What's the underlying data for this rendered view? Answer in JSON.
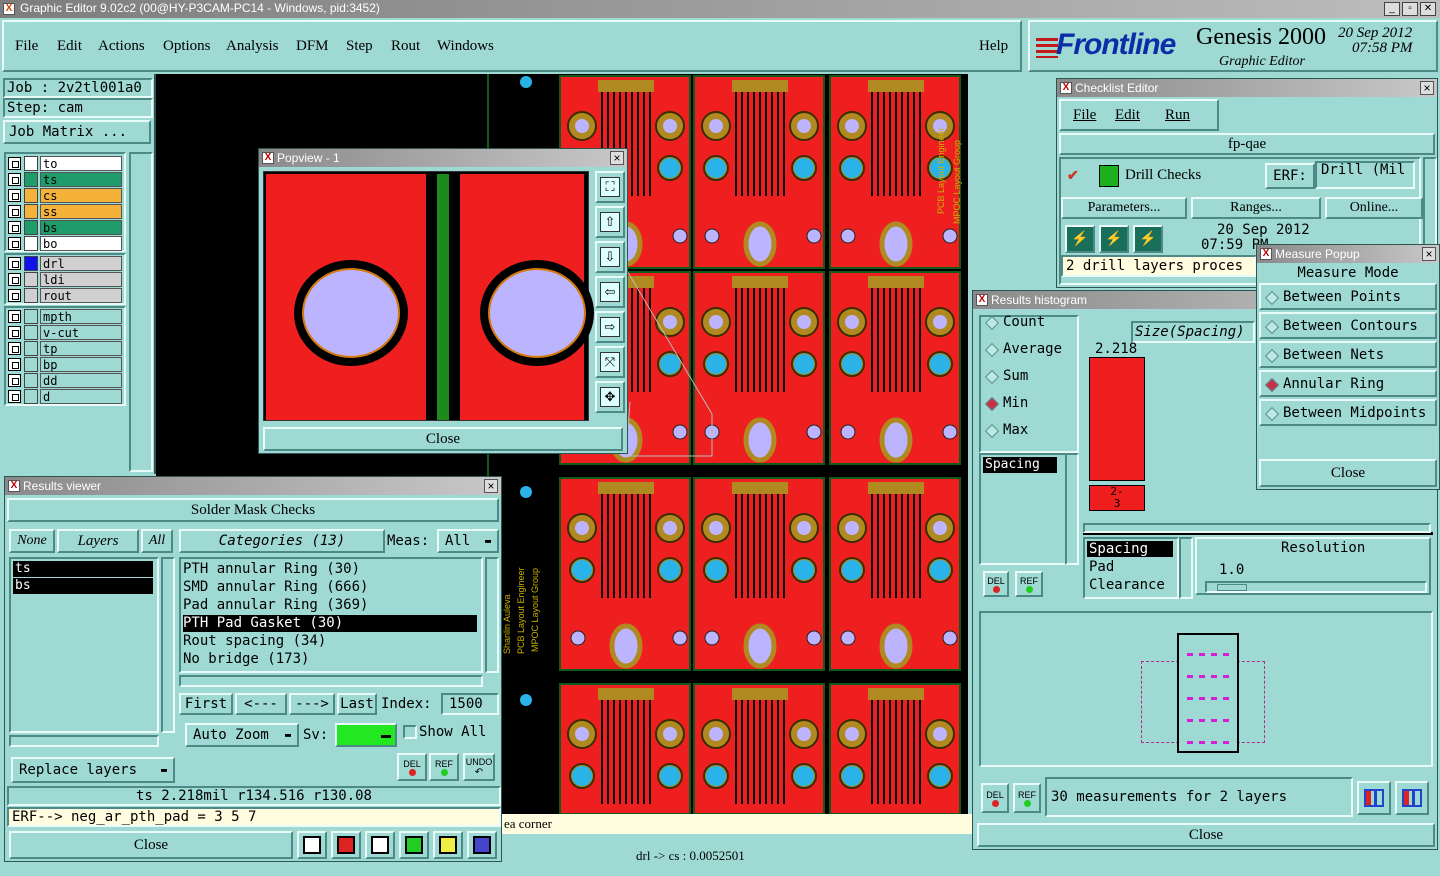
{
  "window": {
    "title": "Graphic Editor 9.02c2 (00@HY-P3CAM-PC14 - Windows, pid:3452)"
  },
  "menu": {
    "items": [
      "File",
      "Edit",
      "Actions",
      "Options",
      "Analysis",
      "DFM",
      "Step",
      "Rout",
      "Windows"
    ],
    "help": "Help"
  },
  "brand": {
    "logo": "Frontline",
    "product": "Genesis 2000",
    "subtitle": "Graphic Editor",
    "date": "20 Sep 2012",
    "time": "07:58 PM"
  },
  "job": {
    "job_label": "Job : 2v2tl001a0",
    "step_label": "Step: cam",
    "matrix_button": "Job Matrix ..."
  },
  "layers": {
    "group1": [
      {
        "name": "to",
        "color": "#ffffff"
      },
      {
        "name": "ts",
        "color": "#1f9c6a"
      },
      {
        "name": "cs",
        "color": "#f4b23a"
      },
      {
        "name": "ss",
        "color": "#f4b23a"
      },
      {
        "name": "bs",
        "color": "#1f9c6a"
      },
      {
        "name": "bo",
        "color": "#ffffff"
      }
    ],
    "group2": [
      {
        "name": "drl",
        "color": "#1010f0"
      },
      {
        "name": "ldi",
        "color": "#d0d0d0"
      },
      {
        "name": "rout",
        "color": "#d0d0d0"
      }
    ],
    "group3": [
      {
        "name": "mpth",
        "color": "#9ed9d4"
      },
      {
        "name": "v-cut",
        "color": "#9ed9d4"
      },
      {
        "name": "tp",
        "color": "#9ed9d4"
      },
      {
        "name": "bp",
        "color": "#9ed9d4"
      },
      {
        "name": "dd",
        "color": "#9ed9d4"
      },
      {
        "name": "d",
        "color": "#9ed9d4"
      }
    ]
  },
  "popview": {
    "title": "Popview - 1",
    "close": "Close"
  },
  "results_viewer": {
    "title": "Results viewer",
    "header": "Solder Mask Checks",
    "none": "None",
    "layers": "Layers",
    "all": "All",
    "layer_list": [
      "ts",
      "bs"
    ],
    "categories_label": "Categories (13)",
    "meas_label": "Meas:",
    "meas_value": "All",
    "categories": [
      "PTH annular Ring (30)",
      "SMD annular Ring (666)",
      "Pad annular Ring (369)",
      "PTH Pad Gasket (30)",
      "Rout spacing (34)",
      "No bridge (173)"
    ],
    "selected_category": 3,
    "first": "First",
    "prev": "<---",
    "next": "--->",
    "last": "Last",
    "index_label": "Index:",
    "index_value": "1500",
    "auto_zoom": "Auto Zoom",
    "sv_label": "Sv:",
    "show_all": "Show All",
    "replace_layers": "Replace layers",
    "del": "DEL",
    "ref": "REF",
    "undo": "UNDO",
    "info": "ts 2.218mil   r134.516   r130.08",
    "erf": "ERF--> neg_ar_pth_pad = 3 5 7",
    "close": "Close"
  },
  "status": {
    "corner_text": "ea corner",
    "bottom_text": "drl -> cs : 0.0052501"
  },
  "checklist": {
    "title": "Checklist Editor",
    "menu": [
      "File",
      "Edit",
      "Run"
    ],
    "name": "fp-qae",
    "check_name": "Drill Checks",
    "erf_label": "ERF:",
    "erf_value": "Drill (Mil",
    "parameters": "Parameters...",
    "ranges": "Ranges...",
    "online": "Online...",
    "date": "20 Sep 2012",
    "time": "07:59 PM",
    "message": "2 drill layers proces"
  },
  "histogram": {
    "title": "Results histogram",
    "modes": [
      "Count",
      "Average",
      "Sum",
      "Min",
      "Max"
    ],
    "selected_mode": "Min",
    "field_list": [
      "Spacing"
    ],
    "size_label": "Size(Spacing)",
    "bar_value": "2.218",
    "bar_label": "2-\n3",
    "attr_list": [
      "Spacing",
      "Pad",
      "Clearance"
    ],
    "resolution_label": "Resolution",
    "resolution_value": "1.0",
    "summary": "30 measurements for 2 layers",
    "del": "DEL",
    "ref": "REF",
    "close": "Close"
  },
  "measure": {
    "title": "Measure Popup",
    "mode_label": "Measure Mode",
    "modes": [
      "Between Points",
      "Between Contours",
      "Between Nets",
      "Annular Ring",
      "Between Midpoints"
    ],
    "selected": "Annular Ring",
    "close": "Close"
  },
  "pcb": {
    "vertical_text_1": "PCB Layout Engineer",
    "vertical_text_2": "MPOC Layout Group",
    "vertical_text_3": "Shanlin Auleva"
  }
}
